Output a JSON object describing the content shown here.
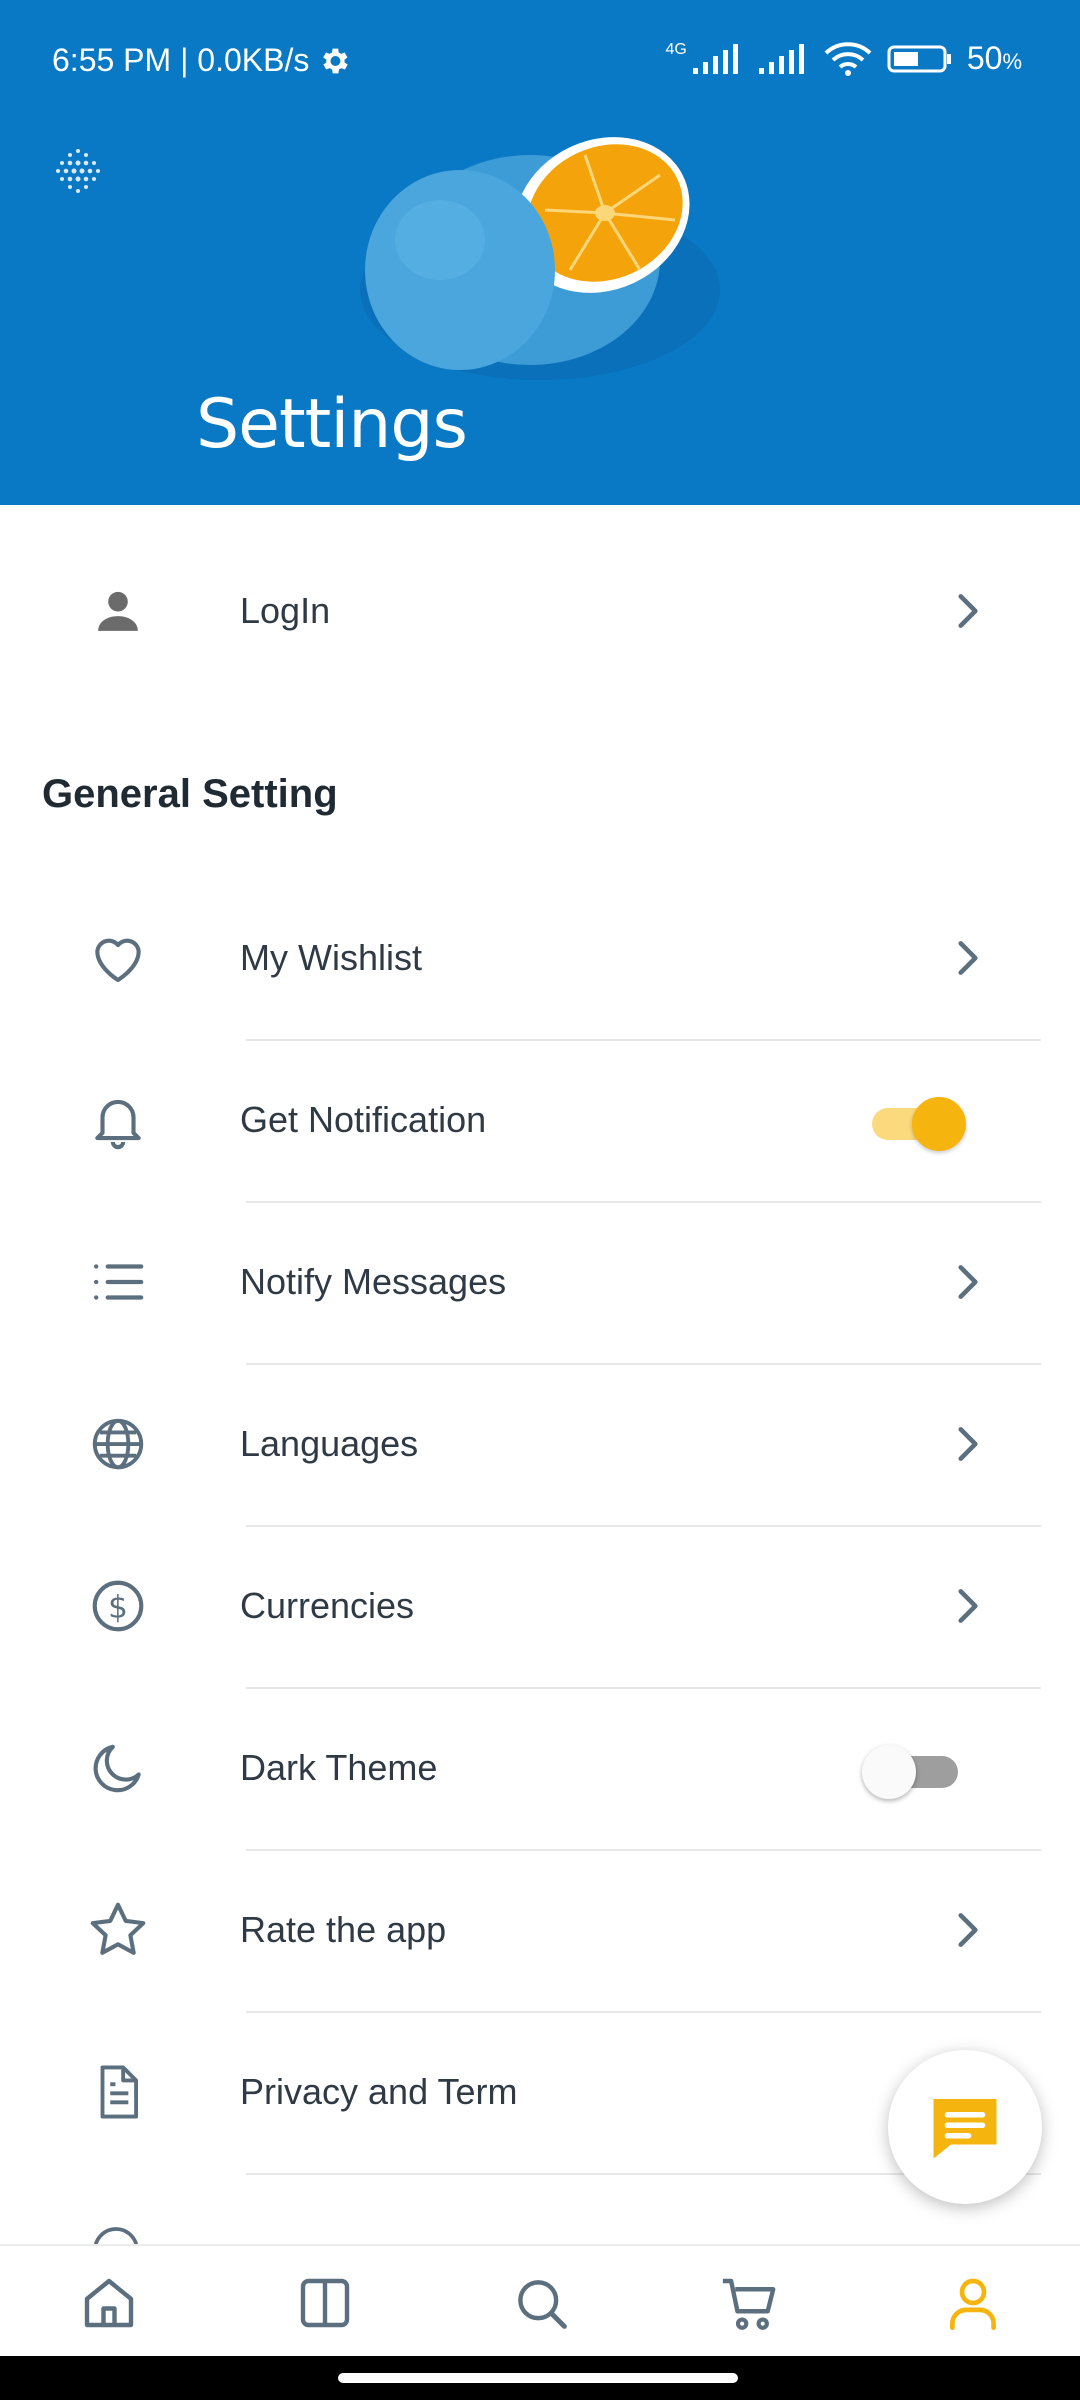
{
  "status_bar": {
    "time": "6:55 PM | 0.0KB/s",
    "network": "4G",
    "battery": "50",
    "battery_unit": "%"
  },
  "header": {
    "title": "Settings"
  },
  "login_row": {
    "label": "LogIn"
  },
  "general": {
    "title": "General Setting",
    "items": [
      {
        "label": "My Wishlist",
        "icon": "heart-icon",
        "control": "chevron"
      },
      {
        "label": "Get Notification",
        "icon": "bell-icon",
        "control": "toggle",
        "on": true
      },
      {
        "label": "Notify Messages",
        "icon": "list-icon",
        "control": "chevron"
      },
      {
        "label": "Languages",
        "icon": "globe-icon",
        "control": "chevron"
      },
      {
        "label": "Currencies",
        "icon": "dollar-icon",
        "control": "chevron"
      },
      {
        "label": "Dark Theme",
        "icon": "moon-icon",
        "control": "toggle",
        "on": false
      },
      {
        "label": "Rate the app",
        "icon": "star-icon",
        "control": "chevron"
      },
      {
        "label": "Privacy and Term",
        "icon": "document-icon",
        "control": "chevron"
      }
    ]
  },
  "bottom_nav": {
    "items": [
      "home-icon",
      "categories-icon",
      "search-icon",
      "cart-icon",
      "account-icon"
    ],
    "active": "account-icon"
  },
  "colors": {
    "header_blue": "#0a79c5",
    "accent": "#f6b40e",
    "icon_gray": "#5c6f7e"
  }
}
